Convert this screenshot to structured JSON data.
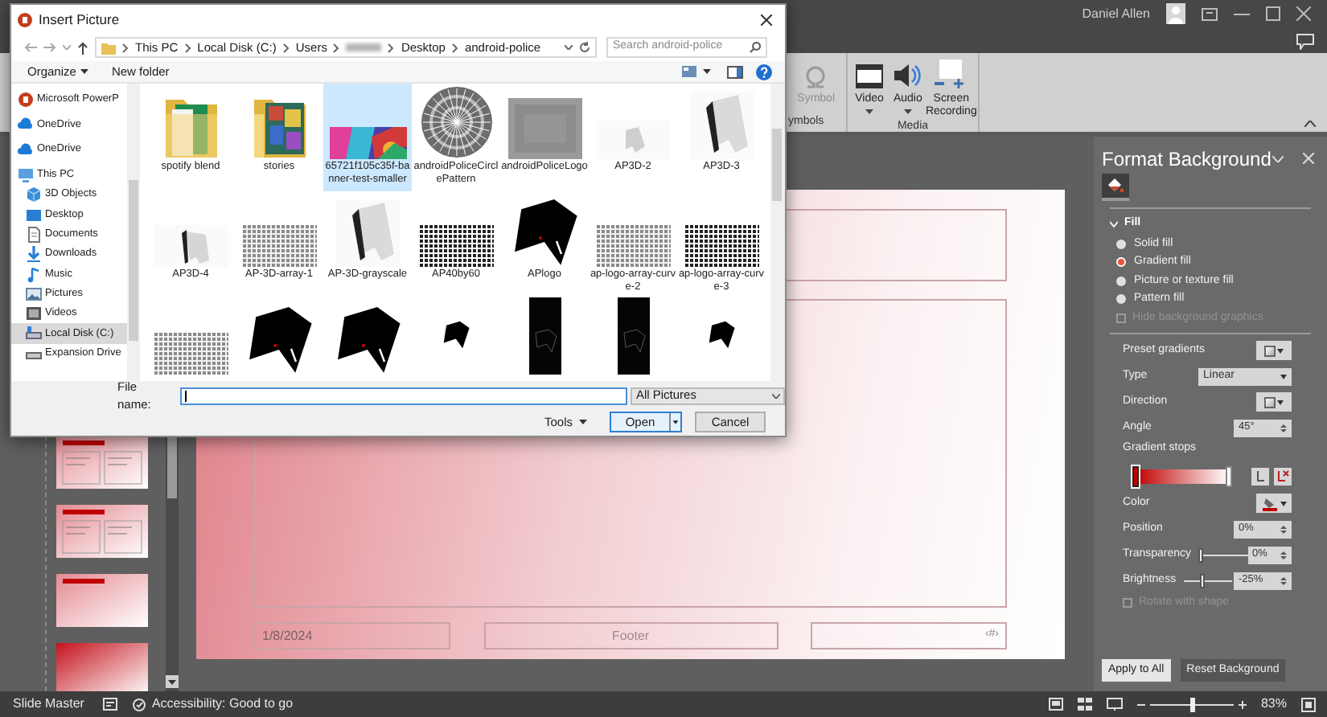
{
  "title_bar": {
    "user_name": "Daniel Allen"
  },
  "ribbon": {
    "groups": [
      {
        "label": "ymbols",
        "buttons": [
          {
            "kind": "symbol",
            "label": "Symbol",
            "disabled": true,
            "dropdown": false
          }
        ]
      },
      {
        "label": "Media",
        "buttons": [
          {
            "kind": "video",
            "label": "Video",
            "disabled": false,
            "dropdown": true
          },
          {
            "kind": "audio",
            "label": "Audio",
            "disabled": false,
            "dropdown": true
          },
          {
            "kind": "screen-recording",
            "label": "Screen Recording",
            "disabled": false,
            "dropdown": false
          }
        ]
      }
    ]
  },
  "dialog": {
    "title": "Insert Picture",
    "breadcrumbs": [
      {
        "kind": "crumb",
        "label": "This PC"
      },
      {
        "kind": "crumb",
        "label": "Local Disk (C:)"
      },
      {
        "kind": "crumb",
        "label": "Users"
      },
      {
        "kind": "redacted"
      },
      {
        "kind": "crumb",
        "label": "Desktop"
      },
      {
        "kind": "crumb",
        "label": "android-police"
      }
    ],
    "search": {
      "placeholder": "Search android-police"
    },
    "toolbar": {
      "organize": "Organize",
      "new_folder": "New folder"
    },
    "nav_items": [
      {
        "kind": "app",
        "label": "Microsoft PowerP",
        "selected": false
      },
      {
        "kind": "cloud",
        "label": "OneDrive",
        "selected": false
      },
      {
        "kind": "cloud",
        "label": "OneDrive",
        "selected": false
      },
      {
        "kind": "pc",
        "label": "This PC",
        "selected": false,
        "children": [
          {
            "kind": "cube",
            "label": "3D Objects",
            "selected": false
          },
          {
            "kind": "desktop",
            "label": "Desktop",
            "selected": false
          },
          {
            "kind": "documents",
            "label": "Documents",
            "selected": false
          },
          {
            "kind": "downloads",
            "label": "Downloads",
            "selected": false
          },
          {
            "kind": "music",
            "label": "Music",
            "selected": false
          },
          {
            "kind": "pictures",
            "label": "Pictures",
            "selected": false
          },
          {
            "kind": "videos",
            "label": "Videos",
            "selected": false
          },
          {
            "kind": "disk",
            "label": "Local Disk (C:)",
            "selected": true
          },
          {
            "kind": "drive",
            "label": "Expansion Drive",
            "selected": false
          }
        ]
      }
    ],
    "files": [
      {
        "kind": "folder-green",
        "name": "spotify blend",
        "selected": false
      },
      {
        "kind": "folder-photos",
        "name": "stories",
        "selected": false
      },
      {
        "name": "65721f105c35f-banner-test-smaller",
        "selected": true
      },
      {
        "kind": "circle",
        "name": "androidPoliceCirclePattern",
        "selected": false
      },
      {
        "kind": "noise",
        "name": "androidPoliceLogo",
        "selected": false
      },
      {
        "kind": "ap3d-light",
        "name": "AP3D-2",
        "selected": false
      },
      {
        "kind": "ap3d",
        "name": "AP3D-3",
        "selected": false
      },
      {
        "kind": "ap3d-wide",
        "name": "AP3D-4",
        "selected": false
      },
      {
        "kind": "grid-light",
        "name": "AP-3D-array-1",
        "selected": false
      },
      {
        "kind": "ap3d",
        "name": "AP-3D-grayscale",
        "selected": false
      },
      {
        "kind": "grid",
        "name": "AP40by60",
        "selected": false
      },
      {
        "kind": "logo",
        "name": "APlogo",
        "selected": false
      },
      {
        "kind": "grid-light",
        "name": "ap-logo-array-curve-2",
        "selected": false
      },
      {
        "kind": "grid",
        "name": "ap-logo-array-curve-3",
        "selected": false
      },
      {
        "kind": "grid-light",
        "selected": false
      },
      {
        "kind": "logo",
        "selected": false
      },
      {
        "kind": "logo",
        "selected": false
      },
      {
        "kind": "tall-white",
        "selected": false
      },
      {
        "kind": "tall-black",
        "selected": false
      },
      {
        "kind": "tall-black",
        "selected": false
      },
      {
        "kind": "tall-white",
        "selected": false
      }
    ],
    "file_name_label": "File name:",
    "file_type": "All Pictures",
    "tools": "Tools",
    "open": "Open",
    "cancel": "Cancel"
  },
  "slide_thumbnails": [
    {
      "kind": "two-content"
    },
    {
      "kind": "two-content"
    },
    {
      "kind": "title-only"
    },
    {
      "kind": "blank"
    }
  ],
  "slide": {
    "date": "1/8/2024",
    "footer": "Footer",
    "slide_number": "‹#›"
  },
  "format_panel": {
    "title": "Format Background",
    "fill": {
      "label": "Fill",
      "expanded": true,
      "options": [
        {
          "label": "Solid fill",
          "selected": false
        },
        {
          "label": "Gradient fill",
          "selected": true
        },
        {
          "label": "Picture or texture fill",
          "selected": false
        },
        {
          "label": "Pattern fill",
          "selected": false
        }
      ],
      "hide_background_graphics": {
        "label": "Hide background graphics",
        "checked": false,
        "disabled": true
      },
      "preset_gradients": {
        "label": "Preset gradients"
      },
      "type": {
        "label": "Type",
        "value": "Linear"
      },
      "direction": {
        "label": "Direction"
      },
      "angle": {
        "label": "Angle",
        "value": "45°"
      },
      "gradient_stops": {
        "label": "Gradient stops",
        "stops": [
          {
            "level": 0,
            "color": "#c00000",
            "selected": true
          },
          {
            "level": 1,
            "color": "#ffffff",
            "selected": false
          }
        ]
      },
      "color": {
        "label": "Color"
      },
      "position": {
        "label": "Position",
        "value": "0%"
      },
      "transparency": {
        "label": "Transparency",
        "level": 0,
        "value": "0%"
      },
      "brightness": {
        "label": "Brightness",
        "level": 0.375,
        "value": "-25%"
      },
      "rotate_with_shape": {
        "label": "Rotate with shape",
        "checked": false,
        "disabled": true
      }
    },
    "buttons": [
      {
        "kind": "primary",
        "label": "Apply to All"
      },
      {
        "kind": "secondary",
        "label": "Reset Background"
      }
    ]
  },
  "status_bar": {
    "mode": "Slide Master",
    "accessibility": "Accessibility: Good to go",
    "zoom_slider": {
      "level": 0.5
    },
    "zoom": "83%"
  }
}
